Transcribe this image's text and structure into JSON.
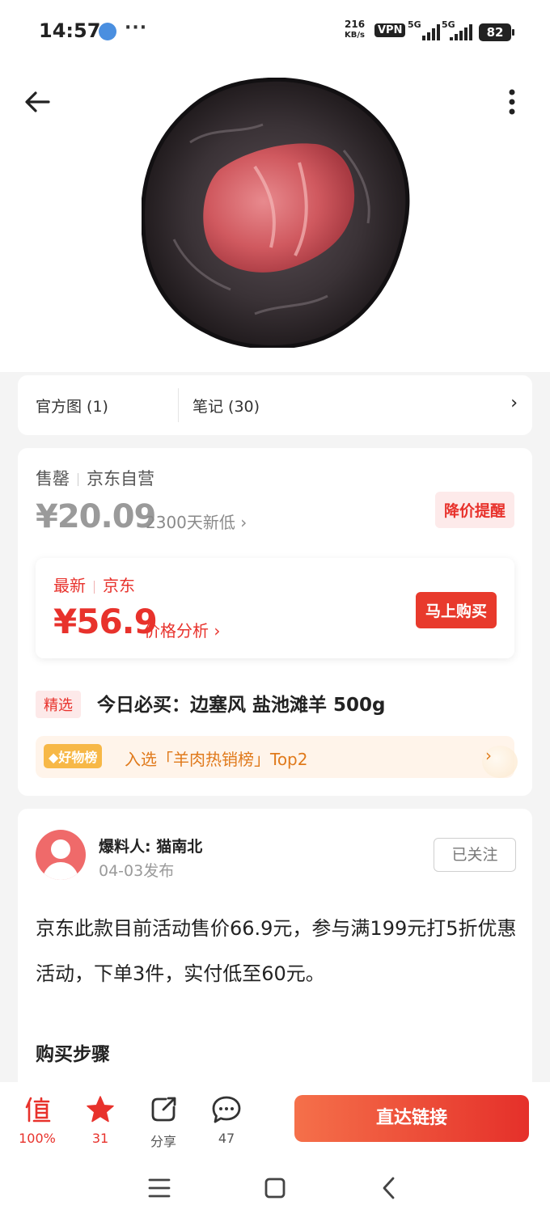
{
  "status_bar": {
    "time": "14:57",
    "dots": "···",
    "speed_value": "216",
    "speed_unit": "KB/s",
    "vpn": "VPN",
    "net1": "5G",
    "net2": "5G",
    "battery": "82"
  },
  "header": {
    "back_icon": "arrow-left-icon",
    "more_icon": "more-vertical-icon"
  },
  "tabs": [
    {
      "label": "官方图 (1)"
    },
    {
      "label": "笔记 (30)"
    }
  ],
  "price": {
    "seller": "售罄",
    "platform": "京东自营",
    "old_price": "¥20.09",
    "lowest_note": "2300天新低 ›",
    "alert_button": "降价提醒",
    "latest_label": "最新",
    "latest_platform": "京东",
    "latest_price": "¥56.9",
    "analysis_link": "价格分析 ›",
    "buy_button": "马上购买"
  },
  "product": {
    "tag": "精选",
    "title": "今日必买：边塞风 盐池滩羊 500g"
  },
  "rank": {
    "badge": "好物榜",
    "text": "入选「羊肉热销榜」Top2",
    "arrow": "›"
  },
  "post": {
    "author": "爆料人: 猫南北",
    "date": "04-03发布",
    "follow_button": "已关注",
    "body": "京东此款目前活动售价66.9元，参与满199元打5折优惠活动，下单3件，实付低至60元。",
    "steps_title": "购买步骤"
  },
  "bottom_bar": {
    "worth_label": "100%",
    "favorite_count": "31",
    "share_label": "分享",
    "comment_count": "47",
    "cta": "直达链接"
  },
  "colors": {
    "accent": "#e8322c",
    "rank_text": "#e07a1c"
  }
}
